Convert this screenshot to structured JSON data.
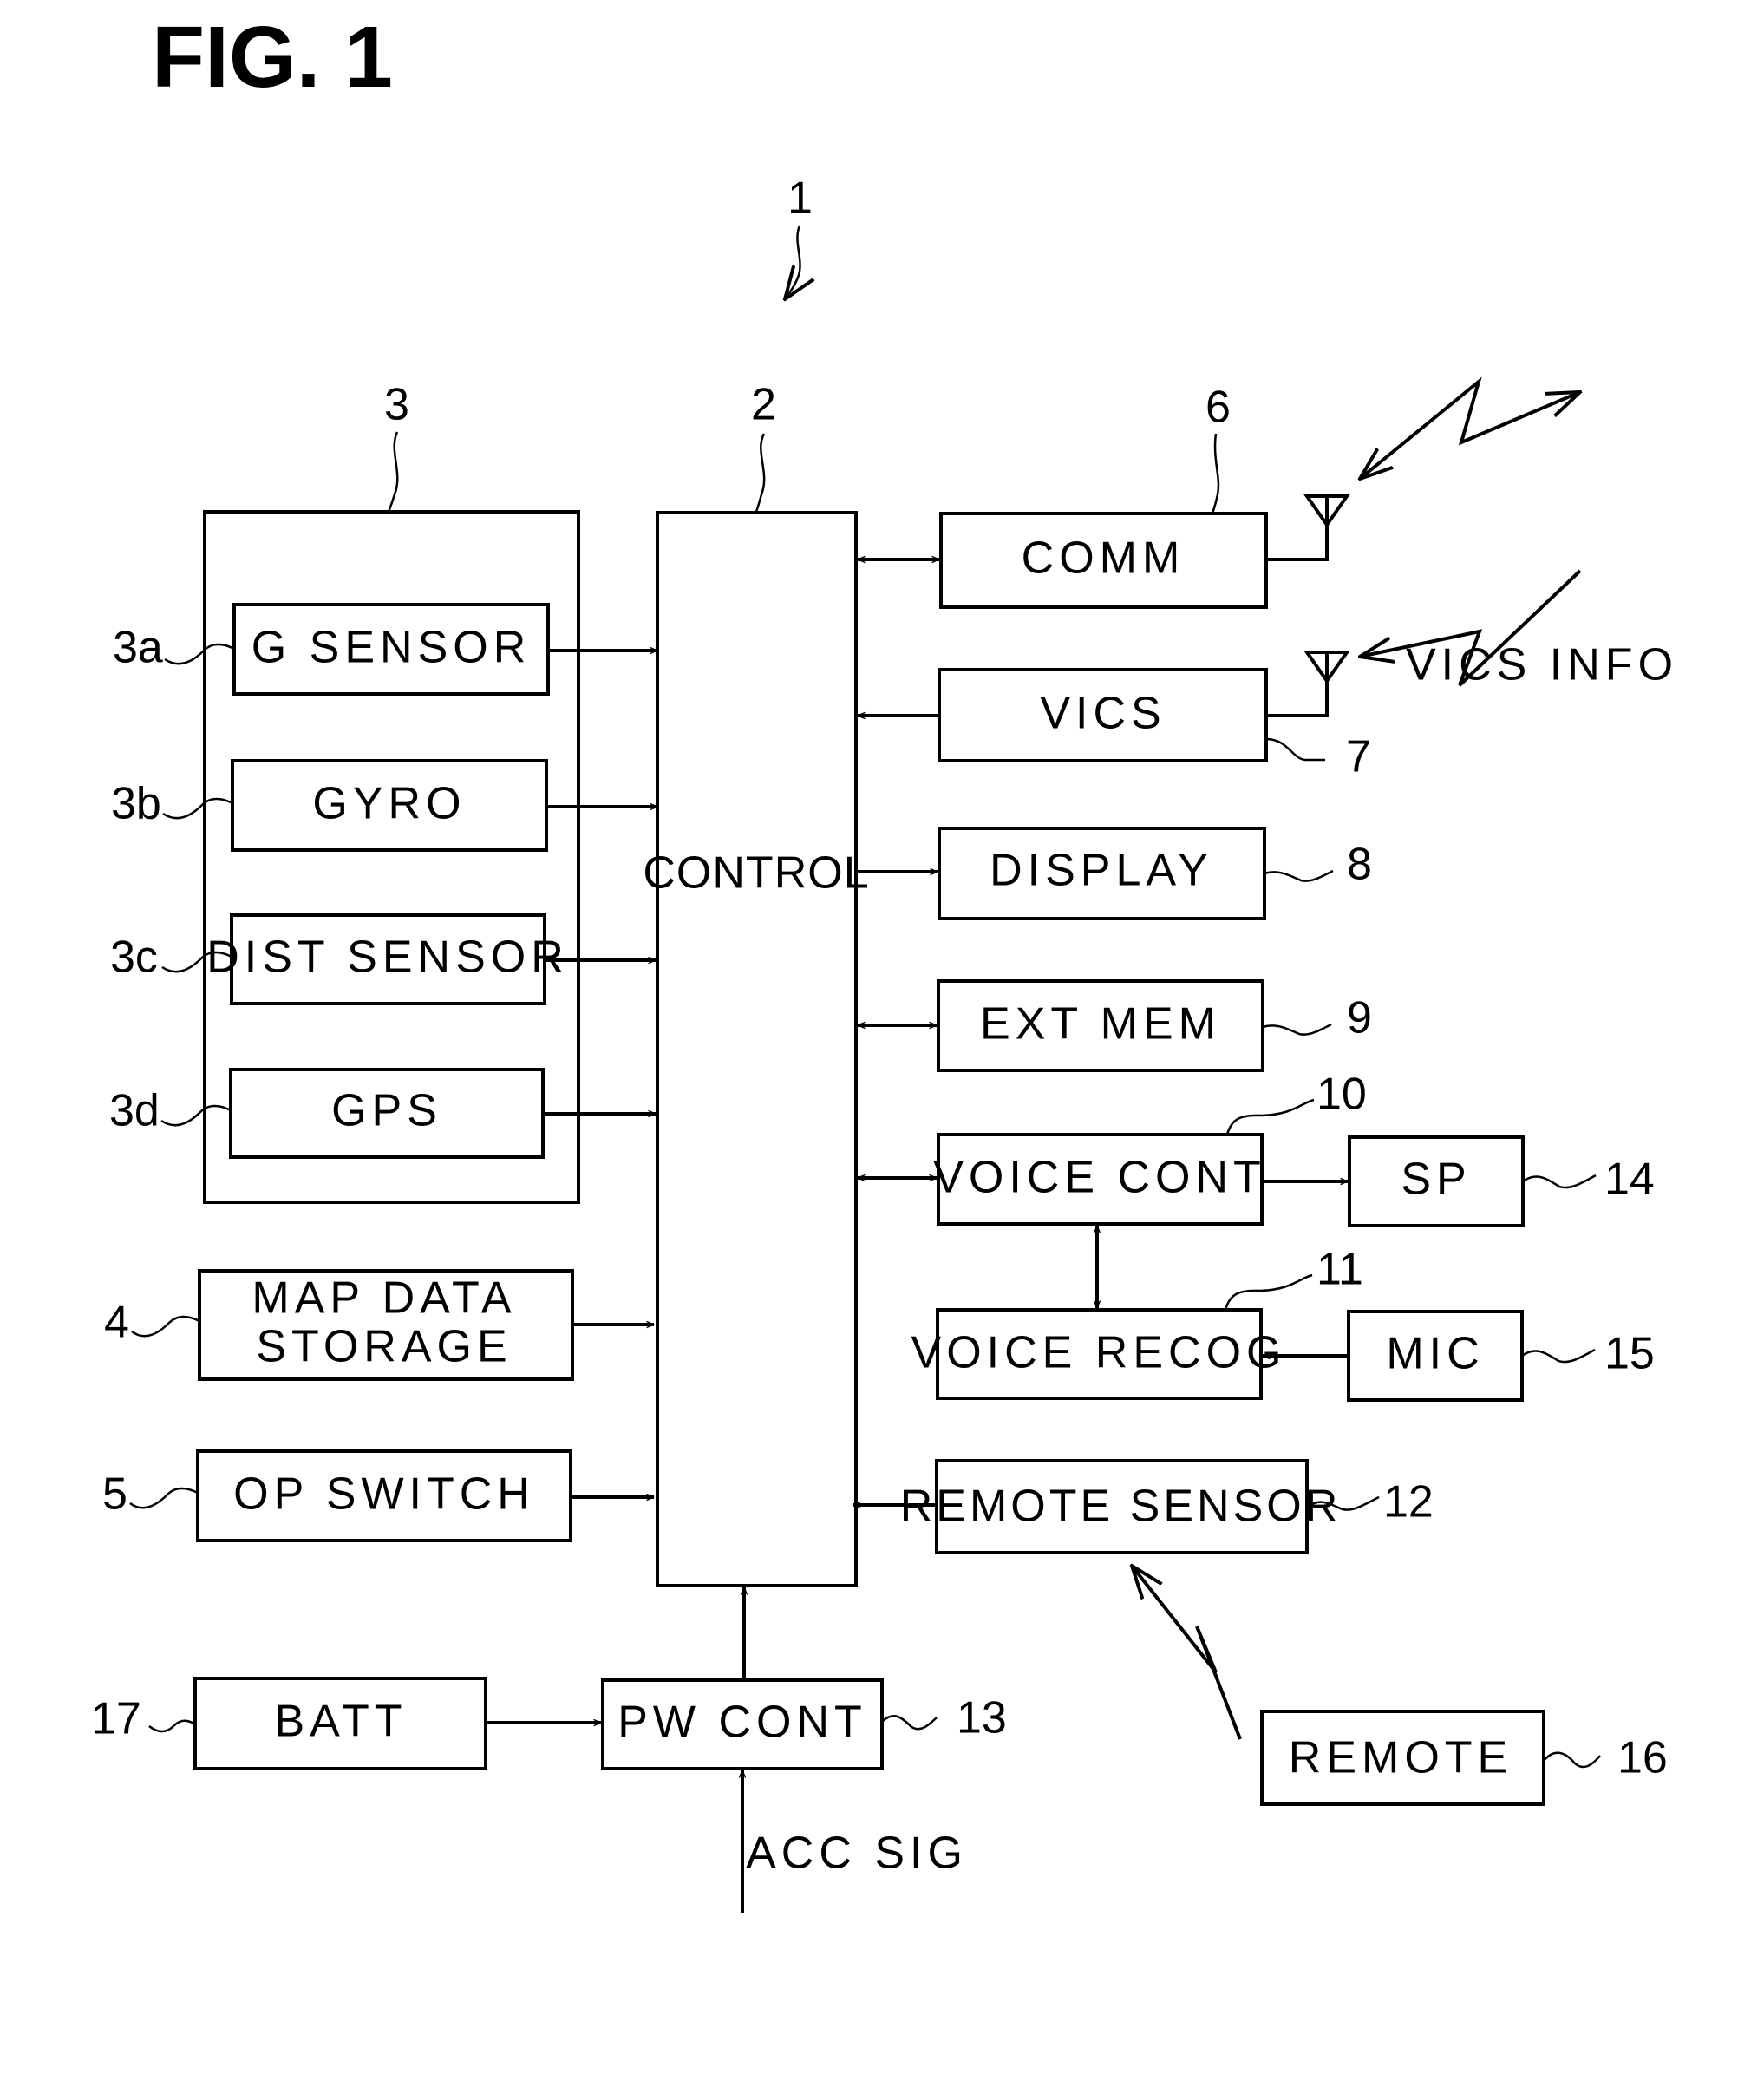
{
  "figure": {
    "title": "FIG. 1",
    "system_ref": "1"
  },
  "blocks": {
    "control": {
      "label": "CONTROL",
      "ref": "2"
    },
    "sensor_group": {
      "ref": "3"
    },
    "g_sensor": {
      "label": "G SENSOR",
      "ref": "3a"
    },
    "gyro": {
      "label": "GYRO",
      "ref": "3b"
    },
    "dist_sensor": {
      "label": "DIST SENSOR",
      "ref": "3c"
    },
    "gps": {
      "label": "GPS",
      "ref": "3d"
    },
    "map_data_storage": {
      "line1": "MAP DATA",
      "line2": "STORAGE",
      "ref": "4"
    },
    "op_switch": {
      "label": "OP SWITCH",
      "ref": "5"
    },
    "comm": {
      "label": "COMM",
      "ref": "6"
    },
    "vics": {
      "label": "VICS",
      "ref": "7"
    },
    "display": {
      "label": "DISPLAY",
      "ref": "8"
    },
    "ext_mem": {
      "label": "EXT MEM",
      "ref": "9"
    },
    "voice_cont": {
      "label": "VOICE CONT",
      "ref": "10"
    },
    "voice_recog": {
      "label": "VOICE RECOG",
      "ref": "11"
    },
    "remote_sensor": {
      "label": "REMOTE SENSOR",
      "ref": "12"
    },
    "pw_cont": {
      "label": "PW CONT",
      "ref": "13"
    },
    "sp": {
      "label": "SP",
      "ref": "14"
    },
    "mic": {
      "label": "MIC",
      "ref": "15"
    },
    "remote": {
      "label": "REMOTE",
      "ref": "16"
    },
    "batt": {
      "label": "BATT",
      "ref": "17"
    }
  },
  "annotations": {
    "vics_info": "VICS INFO",
    "acc_sig": "ACC SIG"
  },
  "connections": [
    {
      "from": "G SENSOR",
      "to": "CONTROL",
      "type": "one-way"
    },
    {
      "from": "GYRO",
      "to": "CONTROL",
      "type": "one-way"
    },
    {
      "from": "DIST SENSOR",
      "to": "CONTROL",
      "type": "one-way"
    },
    {
      "from": "GPS",
      "to": "CONTROL",
      "type": "one-way"
    },
    {
      "from": "MAP DATA STORAGE",
      "to": "CONTROL",
      "type": "one-way"
    },
    {
      "from": "OP SWITCH",
      "to": "CONTROL",
      "type": "one-way"
    },
    {
      "from": "COMM",
      "to": "CONTROL",
      "type": "two-way"
    },
    {
      "from": "VICS",
      "to": "CONTROL",
      "type": "one-way"
    },
    {
      "from": "CONTROL",
      "to": "DISPLAY",
      "type": "one-way"
    },
    {
      "from": "EXT MEM",
      "to": "CONTROL",
      "type": "two-way"
    },
    {
      "from": "VOICE CONT",
      "to": "CONTROL",
      "type": "two-way"
    },
    {
      "from": "VOICE CONT",
      "to": "SP",
      "type": "one-way"
    },
    {
      "from": "VOICE CONT",
      "to": "VOICE RECOG",
      "type": "two-way"
    },
    {
      "from": "MIC",
      "to": "VOICE RECOG",
      "type": "one-way"
    },
    {
      "from": "REMOTE SENSOR",
      "to": "CONTROL",
      "type": "one-way"
    },
    {
      "from": "REMOTE",
      "to": "REMOTE SENSOR",
      "type": "wireless"
    },
    {
      "from": "BATT",
      "to": "PW CONT",
      "type": "one-way"
    },
    {
      "from": "PW CONT",
      "to": "CONTROL",
      "type": "one-way"
    },
    {
      "from": "ACC SIG",
      "to": "PW CONT",
      "type": "one-way"
    }
  ]
}
